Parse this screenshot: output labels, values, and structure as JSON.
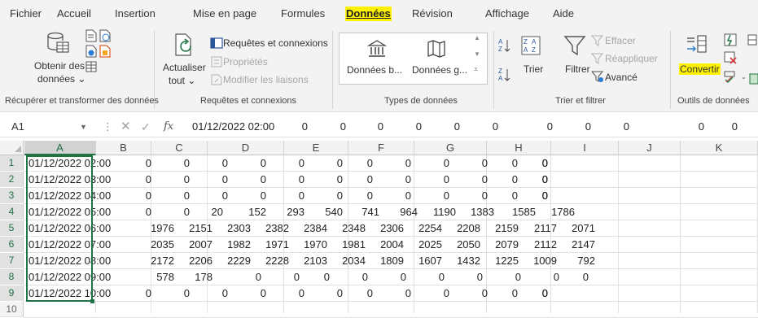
{
  "menu": {
    "tabs": [
      {
        "label": "Fichier",
        "active": false
      },
      {
        "label": "Accueil",
        "active": false
      },
      {
        "label": "Insertion",
        "active": false
      },
      {
        "label": "Mise en page",
        "active": false
      },
      {
        "label": "Formules",
        "active": false
      },
      {
        "label": "Données",
        "active": true
      },
      {
        "label": "Révision",
        "active": false
      },
      {
        "label": "Affichage",
        "active": false
      },
      {
        "label": "Aide",
        "active": false
      }
    ]
  },
  "ribbon": {
    "get_data": {
      "line1": "Obtenir des",
      "line2": "données ⌄"
    },
    "group1_label": "Récupérer et transformer des données",
    "refresh": {
      "line1": "Actualiser",
      "line2": "tout ⌄"
    },
    "queries_connections": "Requêtes et connexions",
    "properties": "Propriétés",
    "edit_links": "Modifier les liaisons",
    "group2_label": "Requêtes et connexions",
    "stocks": "Données b...",
    "geography": "Données g...",
    "group3_label": "Types de données",
    "sort": "Trier",
    "filter": "Filtrer",
    "clear": "Effacer",
    "reapply": "Réappliquer",
    "advanced": "Avancé",
    "group4_label": "Trier et filtrer",
    "convert": "Convertir",
    "group5_label": "Outils de données"
  },
  "formula_bar": {
    "name_box": "A1",
    "fx": "fx",
    "value": "01/12/2022 02:00",
    "trailing_values": [
      "0",
      "0",
      "0",
      "0",
      "0",
      "0",
      "0",
      "0",
      "0",
      "0",
      "0"
    ]
  },
  "grid": {
    "columns": [
      "A",
      "B",
      "C",
      "D",
      "E",
      "F",
      "G",
      "H",
      "I",
      "J",
      "K"
    ],
    "rows": [
      {
        "num": "1",
        "a": "01/12/2022 02:00",
        "values": [
          "0",
          "0",
          "0",
          "0",
          "0",
          "0",
          "0",
          "0",
          "0",
          "0",
          "0",
          "0",
          "0",
          "0"
        ]
      },
      {
        "num": "2",
        "a": "01/12/2022 03:00",
        "values": [
          "0",
          "0",
          "0",
          "0",
          "0",
          "0",
          "0",
          "0",
          "0",
          "0",
          "0",
          "0",
          "0",
          "0"
        ]
      },
      {
        "num": "3",
        "a": "01/12/2022 04:00",
        "values": [
          "0",
          "0",
          "0",
          "0",
          "0",
          "0",
          "0",
          "0",
          "0",
          "0",
          "0",
          "0",
          "0",
          "0"
        ]
      },
      {
        "num": "4",
        "a": "01/12/2022 05:00",
        "values": [
          "0",
          "0",
          "20",
          "152",
          "293",
          "540",
          "741",
          "964",
          "1190",
          "1383",
          "1585",
          "1786"
        ]
      },
      {
        "num": "5",
        "a": "01/12/2022 06:00",
        "values": [
          "1976",
          "2151",
          "2303",
          "2382",
          "2384",
          "2348",
          "2306",
          "2254",
          "2208",
          "2159",
          "2117",
          "2071"
        ]
      },
      {
        "num": "6",
        "a": "01/12/2022 07:00",
        "values": [
          "2035",
          "2007",
          "1982",
          "1971",
          "1970",
          "1981",
          "2004",
          "2025",
          "2050",
          "2079",
          "2112",
          "2147"
        ]
      },
      {
        "num": "7",
        "a": "01/12/2022 08:00",
        "values": [
          "2172",
          "2206",
          "2229",
          "2228",
          "2103",
          "2034",
          "1809",
          "1607",
          "1432",
          "1225",
          "1009",
          "792"
        ]
      },
      {
        "num": "8",
        "a": "01/12/2022 09:00",
        "values": [
          "578",
          "178",
          "0",
          "0",
          "0",
          "0",
          "0",
          "0",
          "0",
          "0",
          "0",
          "0"
        ]
      },
      {
        "num": "9",
        "a": "01/12/2022 10:00",
        "values": [
          "0",
          "0",
          "0",
          "0",
          "0",
          "0",
          "0",
          "0",
          "0",
          "0",
          "0",
          "0",
          "0",
          "0"
        ]
      },
      {
        "num": "10",
        "a": "",
        "values": []
      }
    ]
  },
  "colors": {
    "accent": "#217346",
    "highlight": "#fff200"
  }
}
